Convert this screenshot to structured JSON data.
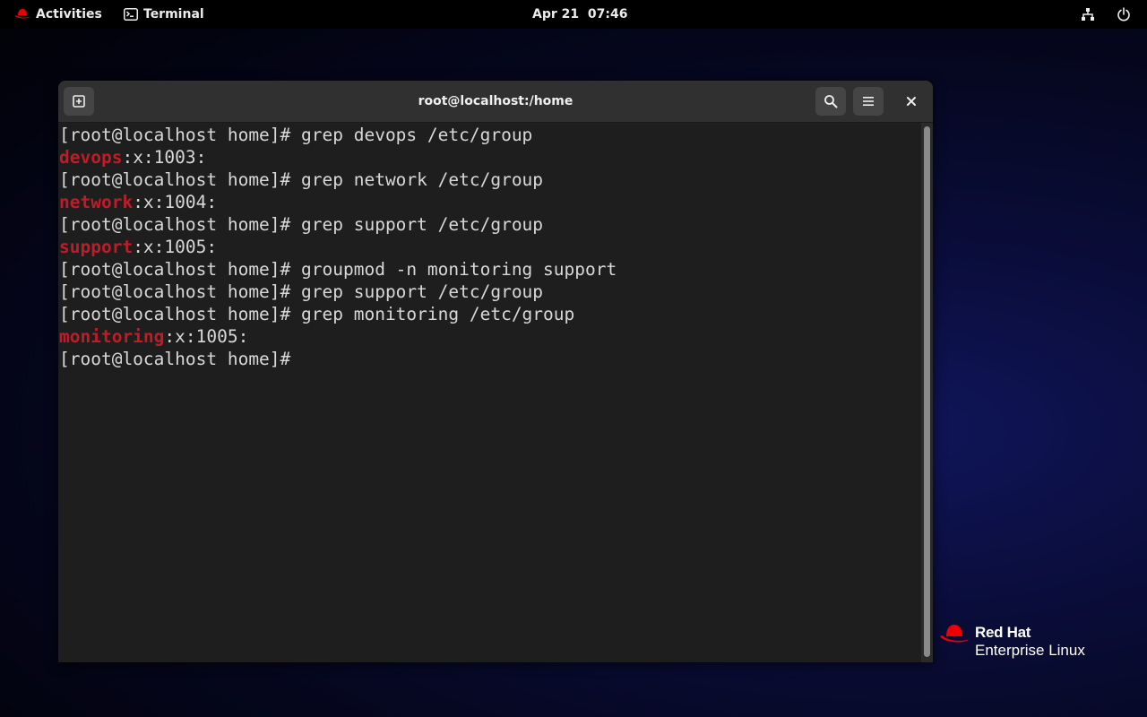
{
  "topbar": {
    "activities_label": "Activities",
    "app_label": "Terminal",
    "clock": "Apr 21  07:46",
    "icons": [
      "redhat-icon",
      "terminal-icon",
      "network-icon",
      "power-icon"
    ]
  },
  "window": {
    "title": "root@localhost:/home",
    "buttons": [
      "new-tab-icon",
      "search-icon",
      "hamburger-menu-icon",
      "close-icon"
    ]
  },
  "terminal": {
    "lines": [
      {
        "hl": "",
        "text": "[root@localhost home]# grep devops /etc/group"
      },
      {
        "hl": "devops",
        "text": ":x:1003:"
      },
      {
        "hl": "",
        "text": "[root@localhost home]# grep network /etc/group"
      },
      {
        "hl": "network",
        "text": ":x:1004:"
      },
      {
        "hl": "",
        "text": "[root@localhost home]# grep support /etc/group"
      },
      {
        "hl": "support",
        "text": ":x:1005:"
      },
      {
        "hl": "",
        "text": "[root@localhost home]# groupmod -n monitoring support"
      },
      {
        "hl": "",
        "text": "[root@localhost home]# grep support /etc/group"
      },
      {
        "hl": "",
        "text": "[root@localhost home]# grep monitoring /etc/group"
      },
      {
        "hl": "monitoring",
        "text": ":x:1005:"
      },
      {
        "hl": "",
        "text": "[root@localhost home]# "
      }
    ],
    "highlight_color": "#c01c28",
    "text_color": "#d8d8d8"
  },
  "logo": {
    "line1": "Red Hat",
    "line2": "Enterprise Linux"
  }
}
